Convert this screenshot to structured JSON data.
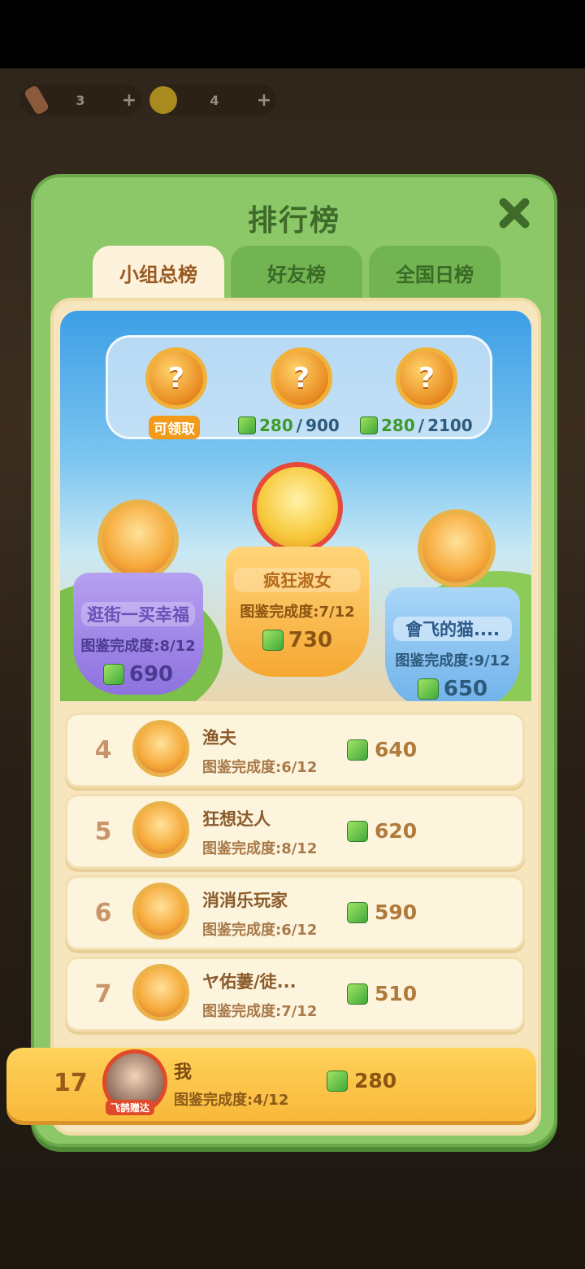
{
  "top_bar": {
    "resource1": {
      "value": "3",
      "plus": "+"
    },
    "resource2": {
      "value": "4",
      "plus": "+"
    }
  },
  "panel": {
    "title": "排行榜",
    "close_icon": "close-icon"
  },
  "tabs": [
    {
      "label": "小组总榜",
      "active": true
    },
    {
      "label": "好友榜",
      "active": false
    },
    {
      "label": "全国日榜",
      "active": false
    }
  ],
  "rewards": {
    "items": [
      {
        "label": "可领取"
      },
      {
        "current": "280",
        "sep": "/",
        "target": "900"
      },
      {
        "current": "280",
        "sep": "/",
        "target": "2100"
      }
    ],
    "chest_symbol": "?"
  },
  "podium": {
    "first": {
      "name": "疯狂淑女",
      "progress": "图鉴完成度:7/12",
      "score": "730"
    },
    "second": {
      "name": "逛街一买幸福",
      "progress": "图鉴完成度:8/12",
      "score": "690"
    },
    "third": {
      "name": "會飞的猫....",
      "progress": "图鉴完成度:9/12",
      "score": "650"
    }
  },
  "list": [
    {
      "rank": "4",
      "name": "渔夫",
      "progress": "图鉴完成度:6/12",
      "score": "640"
    },
    {
      "rank": "5",
      "name": "狂想达人",
      "progress": "图鉴完成度:8/12",
      "score": "620"
    },
    {
      "rank": "6",
      "name": "消消乐玩家",
      "progress": "图鉴完成度:6/12",
      "score": "590"
    },
    {
      "rank": "7",
      "name": "ヤ佑萋/徒...",
      "progress": "图鉴完成度:7/12",
      "score": "510"
    }
  ],
  "me": {
    "rank": "17",
    "name": "我",
    "progress": "图鉴完成度:4/12",
    "score": "280",
    "badge": "飞鹊赠达"
  },
  "colors": {
    "panel_green": "#8cc868",
    "gold_row": "#ffd25a",
    "cream": "#fdf4de"
  }
}
